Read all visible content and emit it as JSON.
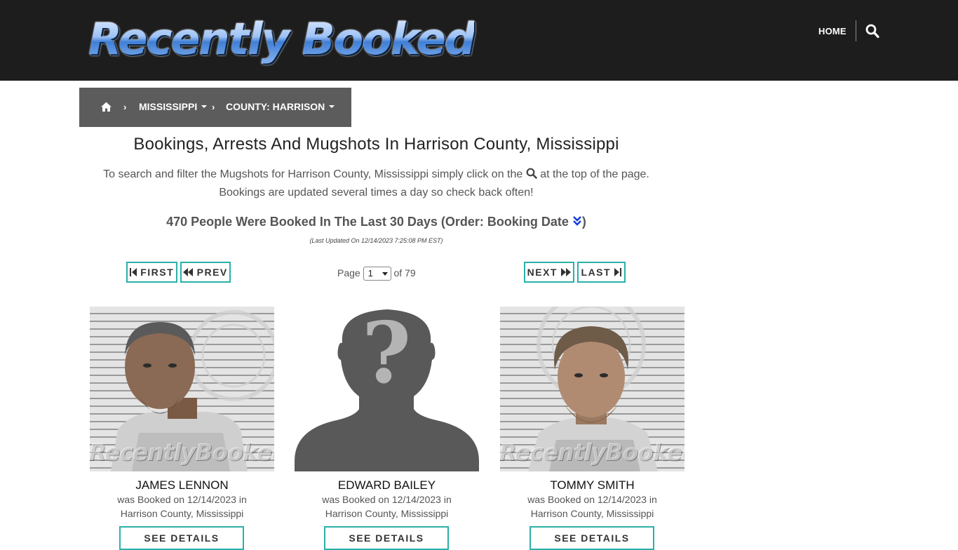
{
  "header": {
    "logo_text": "Recently Booked",
    "nav_home": "HOME",
    "search_icon": "search-icon"
  },
  "breadcrumb": {
    "home_icon": "home-icon",
    "state": "MISSISSIPPI",
    "county": "COUNTY: HARRISON"
  },
  "main": {
    "title": "Bookings, Arrests And Mugshots In Harrison County, Mississippi",
    "intro_part1": "To search and filter the Mugshots for Harrison County, Mississippi simply click on the",
    "intro_part2": "at the top of the page.",
    "intro_line2": "Bookings are updated several times a day so check back often!",
    "count_text": "470 People Were Booked In The Last 30 Days (Order: Booking Date",
    "count_close": ")",
    "last_updated": "(Last Updated On 12/14/2023 7:25:08 PM EST)"
  },
  "pagination": {
    "first": "FIRST",
    "prev": "PREV",
    "page_label": "Page",
    "page_value": "1",
    "of_label": "of 79",
    "next": "NEXT",
    "last": "LAST"
  },
  "cards": [
    {
      "name": "JAMES LENNON",
      "line1": "was Booked on 12/14/2023 in",
      "line2": "Harrison County, Mississippi",
      "button": "SEE DETAILS",
      "photo": "mugshot",
      "watermark": "RecentlyBooked.com"
    },
    {
      "name": "EDWARD BAILEY",
      "line1": "was Booked on 12/14/2023 in",
      "line2": "Harrison County, Mississippi",
      "button": "SEE DETAILS",
      "photo": "placeholder-silhouette"
    },
    {
      "name": "TOMMY SMITH",
      "line1": "was Booked on 12/14/2023 in",
      "line2": "Harrison County, Mississippi",
      "button": "SEE DETAILS",
      "photo": "mugshot",
      "watermark": "RecentlyBooked.com"
    }
  ],
  "colors": {
    "header_bg": "#1d1d1d",
    "breadcrumb_bg": "#5c5c5c",
    "button_border": "#2ab1a8",
    "placeholder_gray": "#595959",
    "order_icon": "#1a3fd0"
  }
}
